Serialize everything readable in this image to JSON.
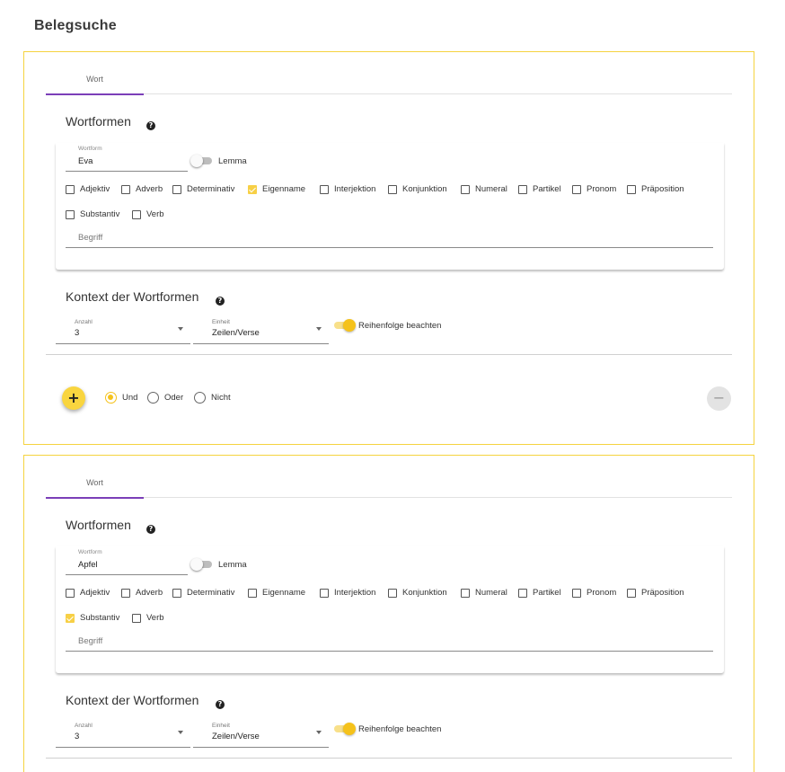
{
  "page": {
    "title": "Belegsuche"
  },
  "blocks": [
    {
      "tab": "Wort",
      "wortformen_title": "Wortformen",
      "help_glyph": "?",
      "wortform": {
        "label": "Wortform",
        "value": "Eva"
      },
      "lemma": {
        "label": "Lemma",
        "on": false
      },
      "pos": [
        {
          "label": "Adjektiv",
          "checked": false
        },
        {
          "label": "Adverb",
          "checked": false
        },
        {
          "label": "Determinativ",
          "checked": false
        },
        {
          "label": "Eigenname",
          "checked": true
        },
        {
          "label": "Interjektion",
          "checked": false
        },
        {
          "label": "Konjunktion",
          "checked": false
        },
        {
          "label": "Numeral",
          "checked": false
        },
        {
          "label": "Partikel",
          "checked": false
        },
        {
          "label": "Pronom",
          "checked": false
        },
        {
          "label": "Präposition",
          "checked": false
        },
        {
          "label": "Substantiv",
          "checked": false
        },
        {
          "label": "Verb",
          "checked": false
        }
      ],
      "begriff_placeholder": "Begriff",
      "kontext_title": "Kontext der Wortformen",
      "anzahl": {
        "label": "Anzahl",
        "value": "3"
      },
      "einheit": {
        "label": "Einheit",
        "value": "Zeilen/Verse"
      },
      "reihenfolge": {
        "label": "Reihenfolge beachten",
        "on": true
      },
      "add_glyph": "+",
      "remove_glyph": "−",
      "logic": [
        {
          "label": "Und",
          "selected": true
        },
        {
          "label": "Oder",
          "selected": false
        },
        {
          "label": "Nicht",
          "selected": false
        }
      ]
    },
    {
      "tab": "Wort",
      "wortformen_title": "Wortformen",
      "help_glyph": "?",
      "wortform": {
        "label": "Wortform",
        "value": "Apfel"
      },
      "lemma": {
        "label": "Lemma",
        "on": false
      },
      "pos": [
        {
          "label": "Adjektiv",
          "checked": false
        },
        {
          "label": "Adverb",
          "checked": false
        },
        {
          "label": "Determinativ",
          "checked": false
        },
        {
          "label": "Eigenname",
          "checked": false
        },
        {
          "label": "Interjektion",
          "checked": false
        },
        {
          "label": "Konjunktion",
          "checked": false
        },
        {
          "label": "Numeral",
          "checked": false
        },
        {
          "label": "Partikel",
          "checked": false
        },
        {
          "label": "Pronom",
          "checked": false
        },
        {
          "label": "Präposition",
          "checked": false
        },
        {
          "label": "Substantiv",
          "checked": true
        },
        {
          "label": "Verb",
          "checked": false
        }
      ],
      "begriff_placeholder": "Begriff",
      "kontext_title": "Kontext der Wortformen",
      "anzahl": {
        "label": "Anzahl",
        "value": "3"
      },
      "einheit": {
        "label": "Einheit",
        "value": "Zeilen/Verse"
      },
      "reihenfolge": {
        "label": "Reihenfolge beachten",
        "on": true
      }
    }
  ],
  "colors": {
    "accent": "#f5c21b",
    "border": "#f5d33f",
    "tab_indicator": "#7b3fb8"
  }
}
